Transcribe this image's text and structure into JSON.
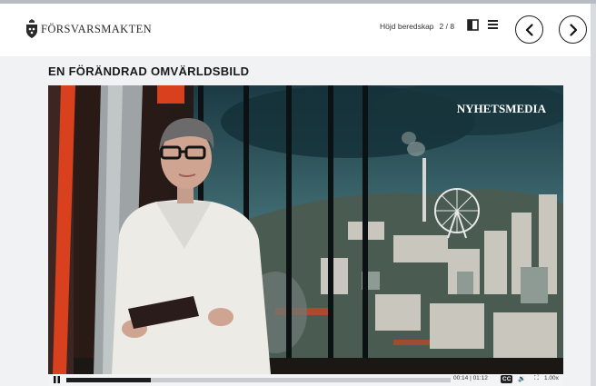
{
  "header": {
    "org_name": "FÖRSVARSMAKTEN",
    "module_name": "Höjd beredskap",
    "progress": "2 / 8"
  },
  "icons": {
    "bookmark": "bookmark-icon",
    "menu": "hamburger-menu-icon",
    "prev": "chevron-left-icon",
    "next": "chevron-right-icon"
  },
  "page": {
    "title": "EN FÖRÄNDRAD OMVÄRLDSBILD"
  },
  "video": {
    "watermark": "NYHETSMEDIA",
    "playback_fraction": 0.22,
    "time": "00:14 | 01:12",
    "cc_label": "CC",
    "speed": "1.00x"
  },
  "colors": {
    "accent_red": "#d9411e",
    "studio_teal": "#1c3d44"
  }
}
